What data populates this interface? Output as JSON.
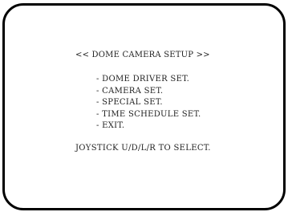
{
  "osd": {
    "title": "<< DOME CAMERA SETUP >>",
    "menu_items": [
      "- DOME DRIVER SET.",
      "- CAMERA SET.",
      "- SPECIAL SET.",
      "- TIME SCHEDULE SET.",
      "- EXIT."
    ],
    "hint": "JOYSTICK U/D/L/R TO SELECT."
  },
  "colors": {
    "border": "#000000",
    "background": "#ffffff",
    "text": "#222222"
  }
}
